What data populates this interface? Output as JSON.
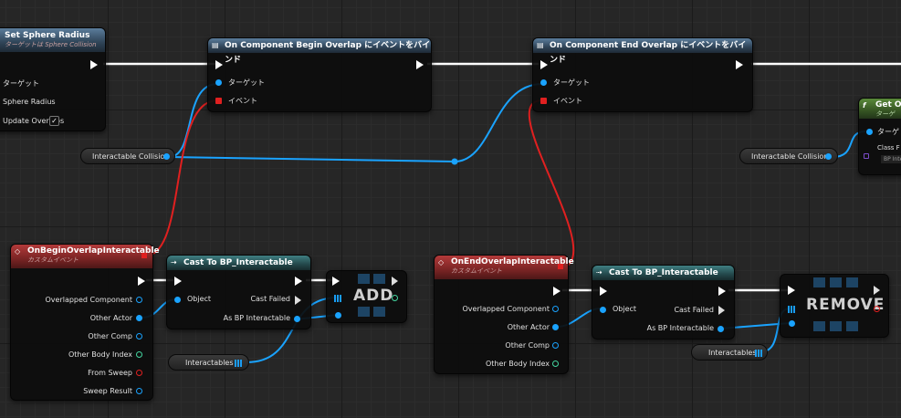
{
  "colors": {
    "exec": "#ffffff",
    "object_pin": "#1aa3ff",
    "event_pin": "#e02020",
    "struct_pin": "#44d6a0",
    "class_pin": "#7b4cc9"
  },
  "set_radius": {
    "title": "Set Sphere Radius",
    "subtitle": "ターゲットは Sphere Collision",
    "pins": [
      "ターゲット",
      "Sphere Radius",
      "Update Overlaps"
    ]
  },
  "bind_begin": {
    "title": "On Component Begin Overlap にイベントをバインド",
    "pins": [
      "ターゲット",
      "イベント"
    ]
  },
  "bind_end": {
    "title": "On Component End Overlap にイベントをバインド",
    "pins": [
      "ターゲット",
      "イベント"
    ]
  },
  "get_over": {
    "title": "Get Ov",
    "subtitle": "ターゲ",
    "pins": [
      "ターゲ",
      "Class F",
      "BP Inte"
    ]
  },
  "var_collision_1": {
    "label": "Interactable Collision"
  },
  "var_collision_2": {
    "label": "Interactable Collision"
  },
  "var_interactables_1": {
    "label": "Interactables"
  },
  "var_interactables_2": {
    "label": "Interactables"
  },
  "begin_event": {
    "title": "OnBeginOverlapInteractable",
    "subtitle": "カスタムイベント",
    "pins": [
      "Overlapped Component",
      "Other Actor",
      "Other Comp",
      "Other Body Index",
      "From Sweep",
      "Sweep Result"
    ]
  },
  "end_event": {
    "title": "OnEndOverlapInteractable",
    "subtitle": "カスタムイベント",
    "pins": [
      "Overlapped Component",
      "Other Actor",
      "Other Comp",
      "Other Body Index"
    ]
  },
  "cast_1": {
    "title": "Cast To BP_Interactable",
    "object": "Object",
    "failed": "Cast Failed",
    "as": "As BP Interactable"
  },
  "cast_2": {
    "title": "Cast To BP_Interactable",
    "object": "Object",
    "failed": "Cast Failed",
    "as": "As BP Interactable"
  },
  "add_node": {
    "label": "ADD"
  },
  "remove_node": {
    "label": "REMOVE"
  }
}
